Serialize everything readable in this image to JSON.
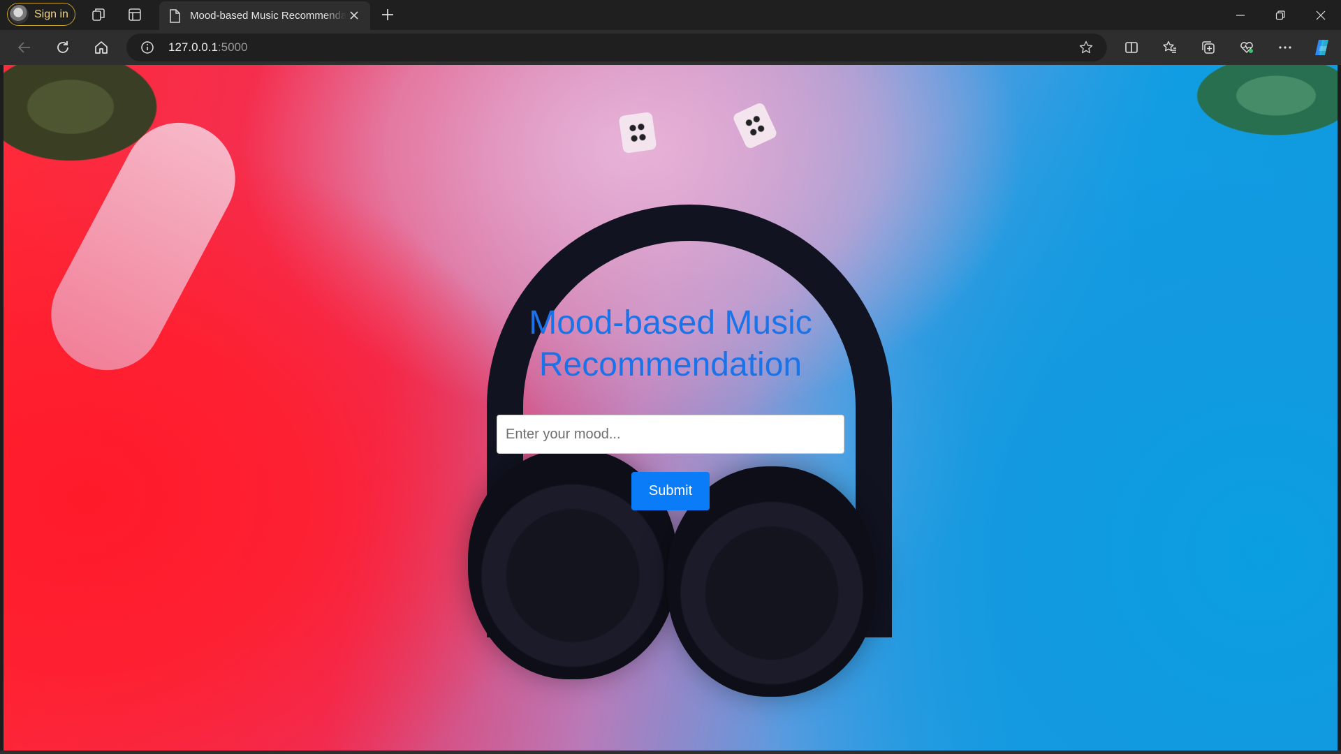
{
  "browser": {
    "profile_label": "Sign in",
    "tab_title": "Mood-based Music Recommendation",
    "address_host": "127.0.0.1",
    "address_port": ":5000"
  },
  "icons": {
    "profile": "avatar-icon",
    "workspaces": "workspaces-icon",
    "tab_actions": "tab-actions-icon",
    "page": "page-icon",
    "close_tab": "close-icon",
    "new_tab": "plus-icon",
    "minimize": "minimize-icon",
    "restore": "restore-icon",
    "close_window": "close-icon",
    "back": "back-arrow-icon",
    "refresh": "refresh-icon",
    "home": "home-icon",
    "site_info": "info-icon",
    "favorite": "star-icon",
    "split_screen": "split-screen-icon",
    "favorites": "favorites-icon",
    "collections": "collections-icon",
    "browser_essentials": "heart-pulse-icon",
    "more": "ellipsis-icon",
    "copilot": "copilot-icon"
  },
  "page": {
    "heading": "Mood-based Music Recommendation",
    "input_placeholder": "Enter your mood...",
    "input_value": "",
    "submit_label": "Submit"
  },
  "colors": {
    "heading": "#1a73e8",
    "button": "#0a7cf7",
    "profile_border": "#c9a227"
  }
}
